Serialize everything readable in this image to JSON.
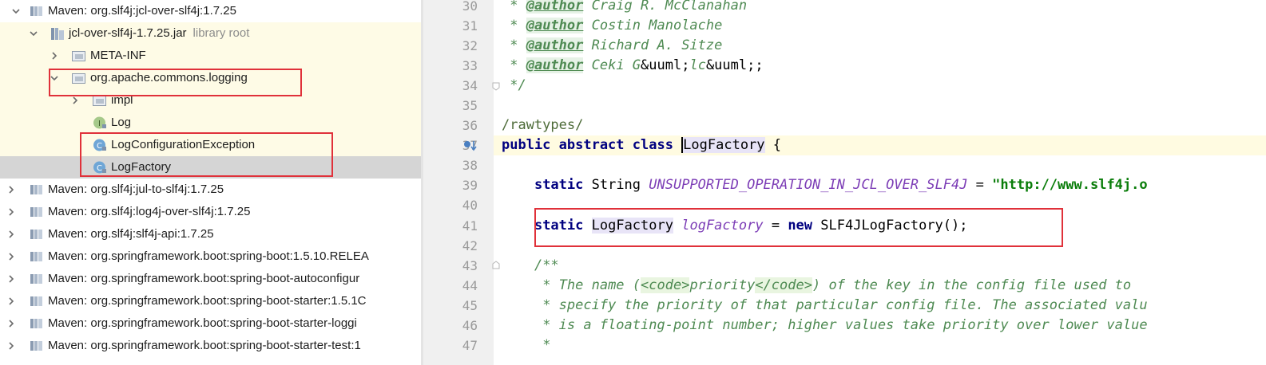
{
  "tree": {
    "items": [
      {
        "label": "Maven: org.slf4j:jcl-over-slf4j:1.7.25",
        "icon": "library-icon",
        "arrow": "expanded"
      },
      {
        "label": "jcl-over-slf4j-1.7.25.jar",
        "sub": "library root",
        "icon": "jar-icon",
        "arrow": "expanded"
      },
      {
        "label": "META-INF",
        "icon": "package-icon",
        "arrow": "collapsed"
      },
      {
        "label": "org.apache.commons.logging",
        "icon": "package-icon",
        "arrow": "expanded"
      },
      {
        "label": "impl",
        "icon": "package-icon",
        "arrow": "collapsed"
      },
      {
        "label": "Log",
        "icon": "interface-icon",
        "arrow": "none"
      },
      {
        "label": "LogConfigurationException",
        "icon": "class-icon",
        "arrow": "none"
      },
      {
        "label": "LogFactory",
        "icon": "class-icon",
        "arrow": "none"
      },
      {
        "label": "Maven: org.slf4j:jul-to-slf4j:1.7.25",
        "icon": "library-icon",
        "arrow": "collapsed"
      },
      {
        "label": "Maven: org.slf4j:log4j-over-slf4j:1.7.25",
        "icon": "library-icon",
        "arrow": "collapsed"
      },
      {
        "label": "Maven: org.slf4j:slf4j-api:1.7.25",
        "icon": "library-icon",
        "arrow": "collapsed"
      },
      {
        "label": "Maven: org.springframework.boot:spring-boot:1.5.10.RELEA",
        "icon": "library-icon",
        "arrow": "collapsed"
      },
      {
        "label": "Maven: org.springframework.boot:spring-boot-autoconfigur",
        "icon": "library-icon",
        "arrow": "collapsed"
      },
      {
        "label": "Maven: org.springframework.boot:spring-boot-starter:1.5.1C",
        "icon": "library-icon",
        "arrow": "collapsed"
      },
      {
        "label": "Maven: org.springframework.boot:spring-boot-starter-loggi",
        "icon": "library-icon",
        "arrow": "collapsed"
      },
      {
        "label": "Maven: org.springframework.boot:spring-boot-starter-test:1",
        "icon": "library-icon",
        "arrow": "collapsed"
      }
    ],
    "interface_badge": "I",
    "class_badge": "C"
  },
  "editor": {
    "line_numbers": [
      "30",
      "31",
      "32",
      "33",
      "34",
      "35",
      "36",
      "37",
      "38",
      "39",
      "40",
      "41",
      "42",
      "43",
      "44",
      "45",
      "46",
      "47"
    ],
    "code": {
      "l30_star": " * ",
      "l30_tag": "@author",
      "l30_text": " Craig R. McClanahan",
      "l31_star": " * ",
      "l31_tag": "@author",
      "l31_text": " Costin Manolache",
      "l32_star": " * ",
      "l32_tag": "@author",
      "l32_text": " Richard A. Sitze",
      "l33_star": " * ",
      "l33_tag": "@author",
      "l33_text": " Ceki G",
      "l33_ent1": "&uuml;",
      "l33_mid": "lc",
      "l33_ent2": "&uuml;",
      "l33_end": ";",
      "l34": " */",
      "l36": "/rawtypes/",
      "l37_kw": "public abstract class ",
      "l37_cls": "LogFactory",
      "l37_end": " {",
      "l39_kw": "static",
      "l39_type": " String ",
      "l39_field": "UNSUPPORTED_OPERATION_IN_JCL_OVER_SLF4J",
      "l39_eq": " = ",
      "l39_str": "\"http://www.slf4j.o",
      "l41_kw": "static",
      "l41_sp": " ",
      "l41_cls": "LogFactory",
      "l41_sp2": " ",
      "l41_field": "logFactory",
      "l41_eq": " = ",
      "l41_new": "new",
      "l41_rest": " SLF4JLogFactory();",
      "l43": "/**",
      "l44_a": " * The name (",
      "l44_code1": "<code>",
      "l44_b": "priority",
      "l44_code2": "</code>",
      "l44_c": ") of the key in the config file used to",
      "l45": " * specify the priority of that particular config file. The associated valu",
      "l46": " * is a floating-point number; higher values take priority over lower value",
      "l47": " *"
    }
  },
  "colors": {
    "highlight_box": "#e0313a",
    "library_bg": "#fefbe6",
    "selected_bg": "#d5d5d5"
  }
}
